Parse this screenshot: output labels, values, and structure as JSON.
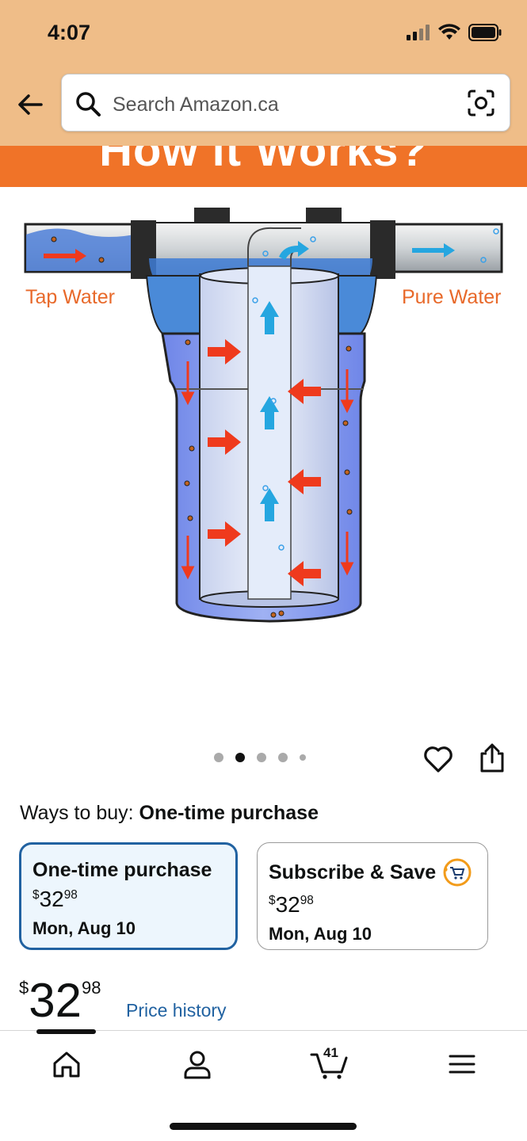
{
  "status_bar": {
    "time": "4:07"
  },
  "search": {
    "placeholder": "Search Amazon.ca"
  },
  "product_image": {
    "banner_text": "How it Works?",
    "left_label": "Tap Water",
    "right_label": "Pure Water"
  },
  "carousel": {
    "count": 5,
    "active_index": 1
  },
  "ways_to_buy": {
    "prefix": "Ways to buy:",
    "selected": "One-time purchase"
  },
  "options": [
    {
      "title": "One-time purchase",
      "currency": "$",
      "whole": "32",
      "fraction": "98",
      "date": "Mon, Aug 10",
      "selected": true
    },
    {
      "title": "Subscribe & Save",
      "currency": "$",
      "whole": "32",
      "fraction": "98",
      "date": "Mon, Aug 10",
      "selected": false
    }
  ],
  "price": {
    "currency": "$",
    "whole": "32",
    "fraction": "98",
    "history_link": "Price history"
  },
  "bottom_nav": {
    "cart_count": "41"
  },
  "colors": {
    "header_bg": "#efbd88",
    "banner_bg": "#f07328",
    "link": "#2162a1",
    "selected_border": "#2162a1"
  }
}
